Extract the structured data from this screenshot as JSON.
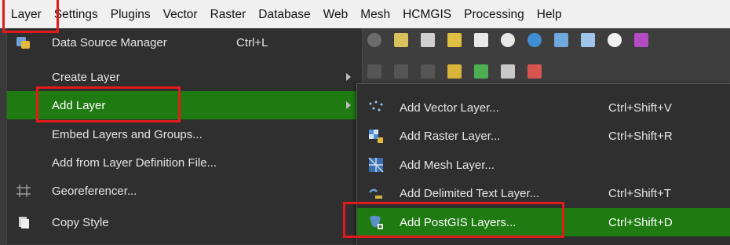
{
  "menubar": {
    "items": [
      "Layer",
      "Settings",
      "Plugins",
      "Vector",
      "Raster",
      "Database",
      "Web",
      "Mesh",
      "HCMGIS",
      "Processing",
      "Help"
    ]
  },
  "layer_menu": {
    "items": [
      {
        "label": "Data Source Manager",
        "shortcut": "Ctrl+L",
        "icon": "data-source-manager-icon"
      },
      {
        "label": "Create Layer",
        "shortcut": "",
        "icon": ""
      },
      {
        "label": "Add Layer",
        "shortcut": "",
        "icon": ""
      },
      {
        "label": "Embed Layers and Groups...",
        "shortcut": "",
        "icon": ""
      },
      {
        "label": "Add from Layer Definition File...",
        "shortcut": "",
        "icon": ""
      },
      {
        "label": "Georeferencer...",
        "shortcut": "",
        "icon": "georeferencer-icon"
      },
      {
        "label": "Copy Style",
        "shortcut": "",
        "icon": "copy-style-icon"
      }
    ]
  },
  "add_layer_submenu": {
    "items": [
      {
        "label": "Add Vector Layer...",
        "shortcut": "Ctrl+Shift+V",
        "icon": "vector-layer-icon"
      },
      {
        "label": "Add Raster Layer...",
        "shortcut": "Ctrl+Shift+R",
        "icon": "raster-layer-icon"
      },
      {
        "label": "Add Mesh Layer...",
        "shortcut": "",
        "icon": "mesh-layer-icon"
      },
      {
        "label": "Add Delimited Text Layer...",
        "shortcut": "Ctrl+Shift+T",
        "icon": "delimited-text-icon"
      },
      {
        "label": "Add PostGIS Layers...",
        "shortcut": "Ctrl+Shift+D",
        "icon": "postgis-icon"
      }
    ]
  },
  "colors": {
    "highlight": "#1f7a12",
    "annotation": "#e21a1a"
  }
}
